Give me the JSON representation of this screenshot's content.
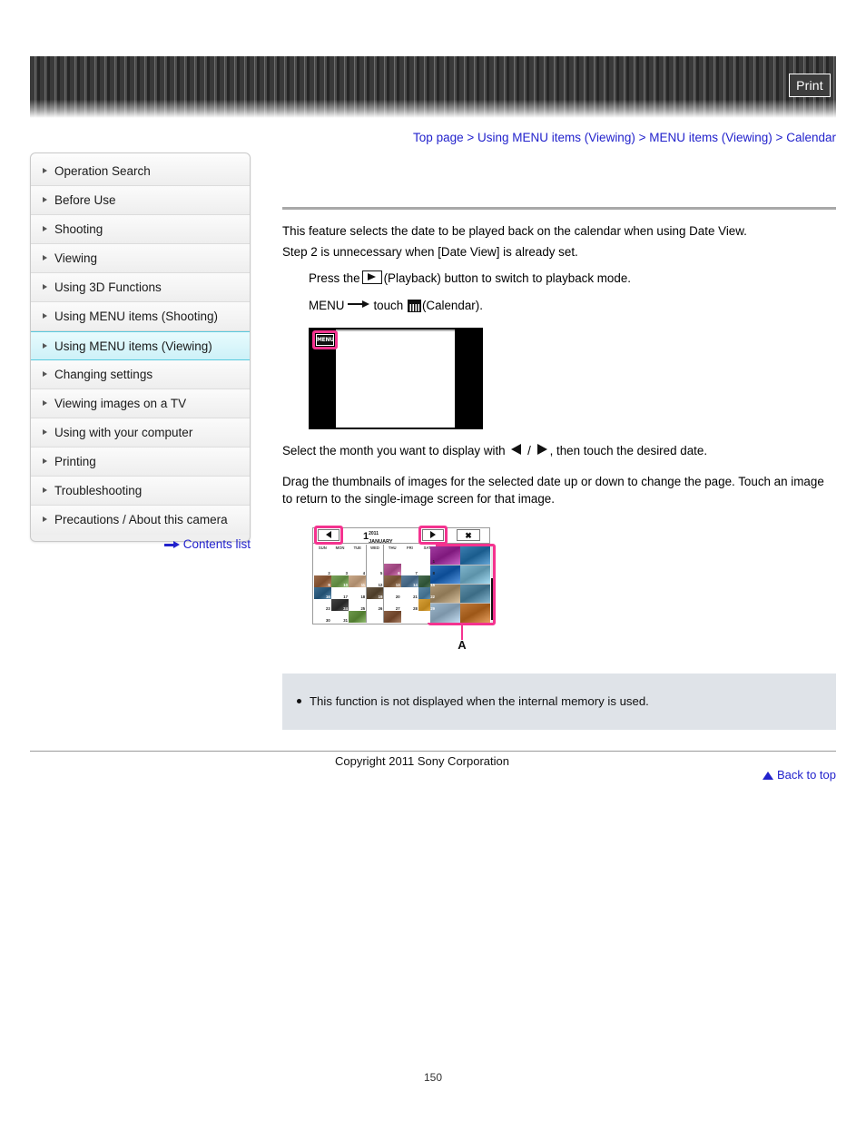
{
  "header": {
    "print_label": "Print"
  },
  "breadcrumb": {
    "separator": ">",
    "items": [
      {
        "label": "Top page"
      },
      {
        "label": "Using MENU items (Viewing)"
      },
      {
        "label": "MENU items (Viewing)"
      },
      {
        "label": "Calendar"
      }
    ]
  },
  "sidebar": {
    "items": [
      {
        "label": "Operation Search",
        "selected": false
      },
      {
        "label": "Before Use",
        "selected": false
      },
      {
        "label": "Shooting",
        "selected": false
      },
      {
        "label": "Viewing",
        "selected": false
      },
      {
        "label": "Using 3D Functions",
        "selected": false
      },
      {
        "label": "Using MENU items (Shooting)",
        "selected": false
      },
      {
        "label": "Using MENU items (Viewing)",
        "selected": true
      },
      {
        "label": "Changing settings",
        "selected": false
      },
      {
        "label": "Viewing images on a TV",
        "selected": false
      },
      {
        "label": "Using with your computer",
        "selected": false
      },
      {
        "label": "Printing",
        "selected": false
      },
      {
        "label": "Troubleshooting",
        "selected": false
      },
      {
        "label": "Precautions / About this camera",
        "selected": false
      }
    ],
    "contents_list_label": "Contents list"
  },
  "main": {
    "intro_line_1": "This feature selects the date to be played back on the calendar when using Date View.",
    "intro_line_2": "Step 2 is unnecessary when [Date View] is already set.",
    "step1_before": "Press the",
    "step1_after": "(Playback) button to switch to playback mode.",
    "step2_menu": "MENU",
    "step2_touch": "touch",
    "step2_after": "(Calendar).",
    "step3_before": "Select the month you want to display with",
    "step3_slash": "/",
    "step3_after": ", then touch the desired date.",
    "step4": "Drag the thumbnails of images for the selected date up or down to change the page. Touch an image to return to the single-image screen for that image."
  },
  "figure_menu": {
    "menu_button_label": "MENU"
  },
  "figure_calendar": {
    "month_number": "1",
    "year": "2011",
    "month_name": "JANUARY",
    "close_label": "✖",
    "callout_label": "A",
    "day_headers": [
      "SUN",
      "MON",
      "TUE",
      "WED",
      "THU",
      "FRI",
      "SAT"
    ],
    "weeks": [
      [
        {
          "day": "",
          "photo": ""
        },
        {
          "day": "",
          "photo": ""
        },
        {
          "day": "",
          "photo": ""
        },
        {
          "day": "",
          "photo": ""
        },
        {
          "day": "",
          "photo": ""
        },
        {
          "day": "",
          "photo": ""
        },
        {
          "day": "1",
          "photo": ""
        }
      ],
      [
        {
          "day": "2",
          "photo": ""
        },
        {
          "day": "3",
          "photo": ""
        },
        {
          "day": "4",
          "photo": ""
        },
        {
          "day": "5",
          "photo": ""
        },
        {
          "day": "6",
          "photo": "#b8609a"
        },
        {
          "day": "7",
          "photo": ""
        },
        {
          "day": "8",
          "photo": ""
        }
      ],
      [
        {
          "day": "9",
          "photo": "#9a6a4a"
        },
        {
          "day": "10",
          "photo": "#7aa35c"
        },
        {
          "day": "11",
          "photo": "#caa98a"
        },
        {
          "day": "12",
          "photo": ""
        },
        {
          "day": "13",
          "photo": "#8d6b4e"
        },
        {
          "day": "14",
          "photo": "#5e7f9c"
        },
        {
          "day": "15",
          "photo": "#4a6e52"
        }
      ],
      [
        {
          "day": "16",
          "photo": "#3f6d8f"
        },
        {
          "day": "17",
          "photo": ""
        },
        {
          "day": "18",
          "photo": ""
        },
        {
          "day": "19",
          "photo": "#6a5a46"
        },
        {
          "day": "20",
          "photo": ""
        },
        {
          "day": "21",
          "photo": ""
        },
        {
          "day": "22",
          "photo": "#5d8aa8"
        }
      ],
      [
        {
          "day": "23",
          "photo": ""
        },
        {
          "day": "24",
          "photo": "#444444"
        },
        {
          "day": "25",
          "photo": ""
        },
        {
          "day": "26",
          "photo": ""
        },
        {
          "day": "27",
          "photo": ""
        },
        {
          "day": "28",
          "photo": ""
        },
        {
          "day": "29",
          "photo": "#d8a13a"
        }
      ],
      [
        {
          "day": "30",
          "photo": ""
        },
        {
          "day": "31",
          "photo": ""
        },
        {
          "day": "",
          "photo": "#6f9a4e"
        },
        {
          "day": "",
          "photo": ""
        },
        {
          "day": "",
          "photo": "#8a6046"
        },
        {
          "day": "",
          "photo": ""
        },
        {
          "day": "",
          "photo": ""
        }
      ]
    ],
    "thumbnails": [
      {
        "color": "#a23ca0"
      },
      {
        "color": "#3d7fb0"
      },
      {
        "color": "#2f6fb8"
      },
      {
        "color": "#7fb5cc"
      },
      {
        "color": "#b09a78"
      },
      {
        "color": "#5f8fa8"
      },
      {
        "color": "#9fb8cc"
      },
      {
        "color": "#c07a3a"
      }
    ]
  },
  "note": {
    "lines": [
      "This function is not displayed when the internal memory is used."
    ]
  },
  "footer": {
    "back_to_top_label": "Back to top",
    "copyright": "Copyright 2011 Sony Corporation",
    "page_number": "150"
  }
}
